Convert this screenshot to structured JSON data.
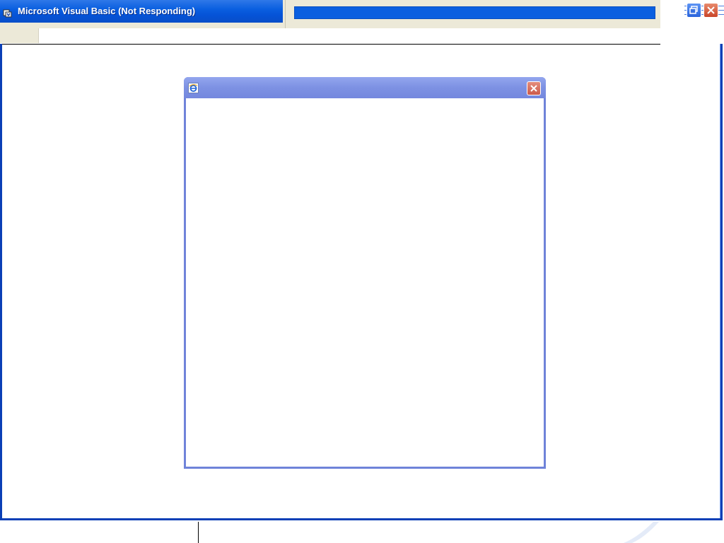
{
  "vb_window": {
    "title": "Microsoft Visual Basic (Not Responding)",
    "busy_progress": 1.0,
    "colors": {
      "titlebar": "#0a5fe0",
      "frame": "#0b3fb6",
      "chrome": "#ece9d8"
    },
    "icons": {
      "app": "vb-app-icon",
      "restore": "restore-icon",
      "close": "close-icon"
    }
  },
  "popup_dialog": {
    "icons": {
      "app": "ie-icon",
      "close": "close-icon"
    },
    "colors": {
      "titlebar": "#7d91e3",
      "close": "#cc5a4a"
    }
  }
}
